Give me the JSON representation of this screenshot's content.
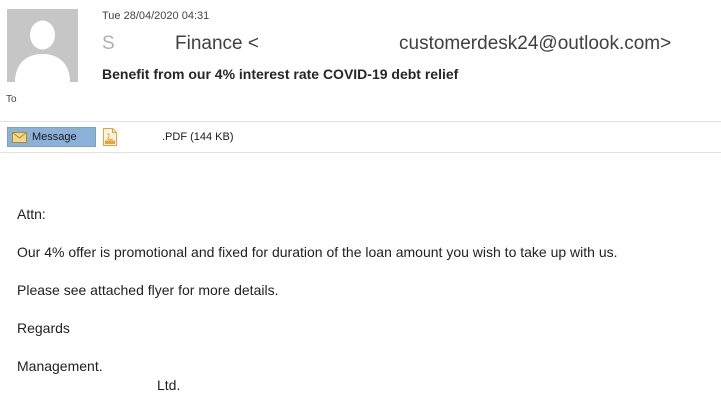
{
  "header": {
    "date": "Tue 28/04/2020 04:31",
    "sender_mark": "S",
    "sender_name": "Finance <",
    "sender_email": "customerdesk24@outlook.com>",
    "subject": "Benefit from our 4% interest rate COVID-19 debt relief",
    "to_label": "To"
  },
  "attachments_bar": {
    "message_tab_label": "Message",
    "attachment_name": ".PDF (144 KB)",
    "message_icon": "envelope-icon",
    "attachment_icon": "pdf-file-icon"
  },
  "body": {
    "lines": [
      "Attn:",
      "Our 4% offer is promotional and fixed for duration of the loan amount you wish to take up with us.",
      "Please see attached flyer for more details.",
      "Regards",
      "Management.",
      "Ltd."
    ]
  },
  "colors": {
    "message_tab_bg": "#8bb1d8",
    "avatar_bg": "#c6c6c6",
    "pdf_icon": "#e8a33a"
  }
}
